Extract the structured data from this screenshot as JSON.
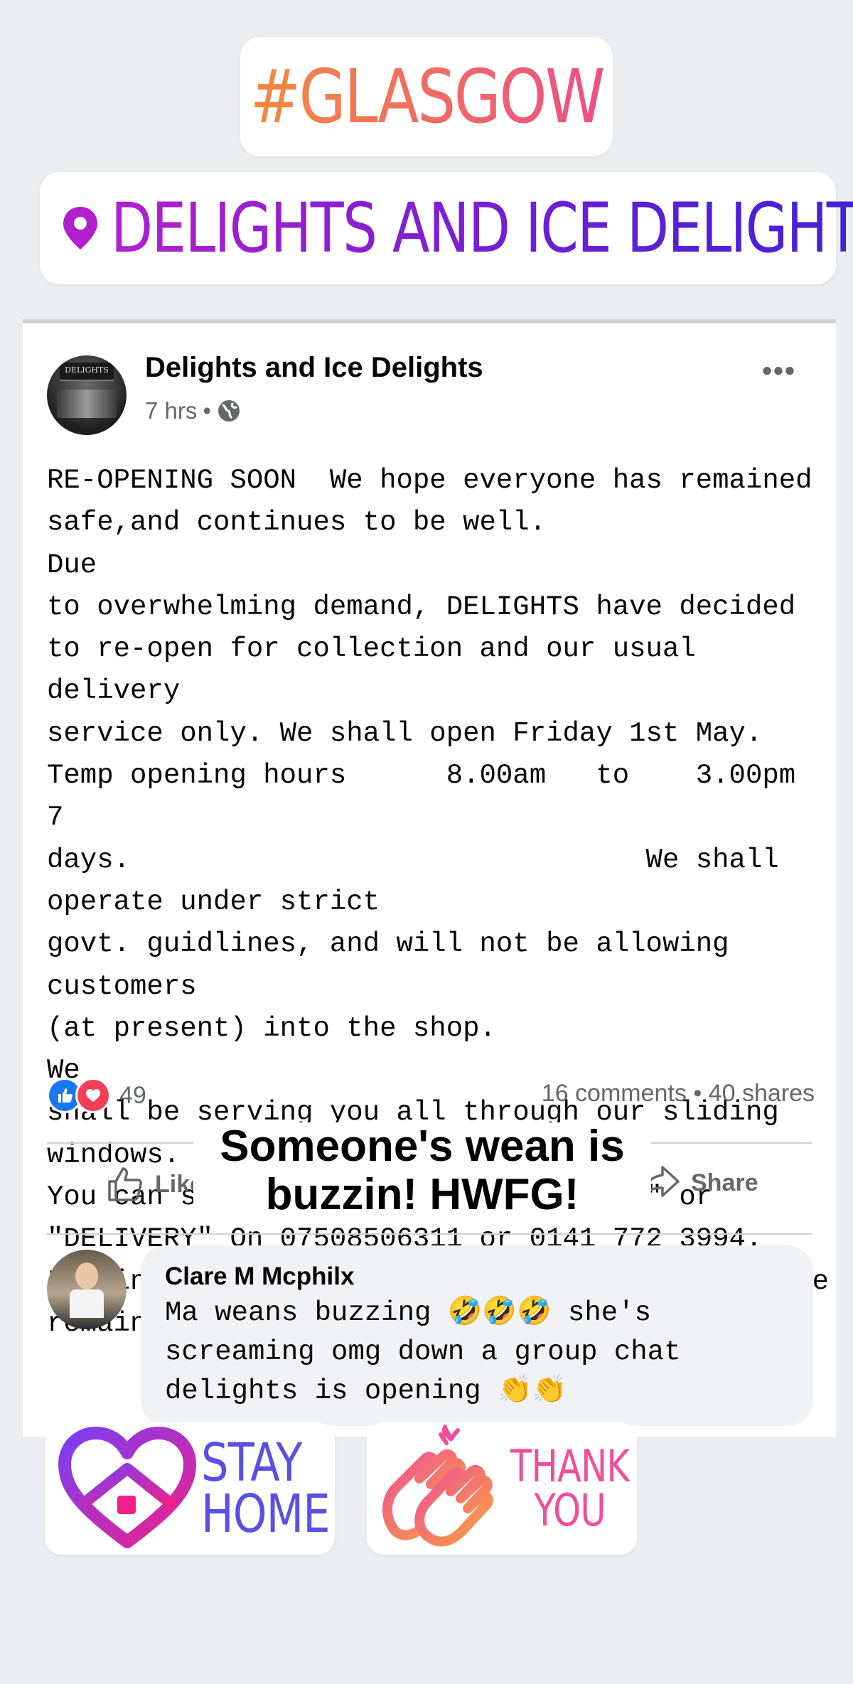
{
  "stickers": {
    "hashtag": "#GLASGOW",
    "location": "DELIGHTS AND ICE DELIGHTS",
    "caption": "Someone's wean is buzzin! HWFG!",
    "stay_home": [
      "STAY",
      "HOME"
    ],
    "thank_you": [
      "THANK",
      "YOU"
    ]
  },
  "post": {
    "page_name": "Delights and Ice Delights",
    "avatar_sign": "DELIGHTS",
    "time": "7 hrs",
    "privacy_icon": "globe-icon",
    "more_icon": "more-icon",
    "body": "RE-OPENING SOON  We hope everyone has remained\nsafe,and continues to be well.                              Due\nto overwhelming demand, DELIGHTS have decided\nto re-open for collection and our usual delivery\nservice only. We shall open Friday 1st May.\nTemp opening hours      8.00am   to    3.00pm  7\ndays.                               We shall operate under strict\ngovt. guidlines, and will not be allowing customers\n(at present) into the shop.                                  We\nshall be serving you all through our sliding windows.\nYou can still phone your \"COLLECTION\" or\n\"DELIVERY\" On 07508506311 or 0141 772 3994.\nLooking forward to seeing you all soon.  Please\nremain safe,and like and share, to pass it on.",
    "reaction_count": "49",
    "stats": "16 comments • 40 shares",
    "like_label": "Like",
    "share_label": "Share"
  },
  "comment": {
    "author": "Clare M Mcphilx",
    "text": "Ma weans buzzing 🤣🤣🤣 she's\nscreaming omg down a group chat\ndelights is opening 👏👏"
  },
  "colors": {
    "facebook_blue": "#1877f2",
    "love_red": "#f33e58",
    "location_purple": "#8a1fd3",
    "hashtag_orange": "#f28a3d",
    "background": "#ebedf0"
  }
}
